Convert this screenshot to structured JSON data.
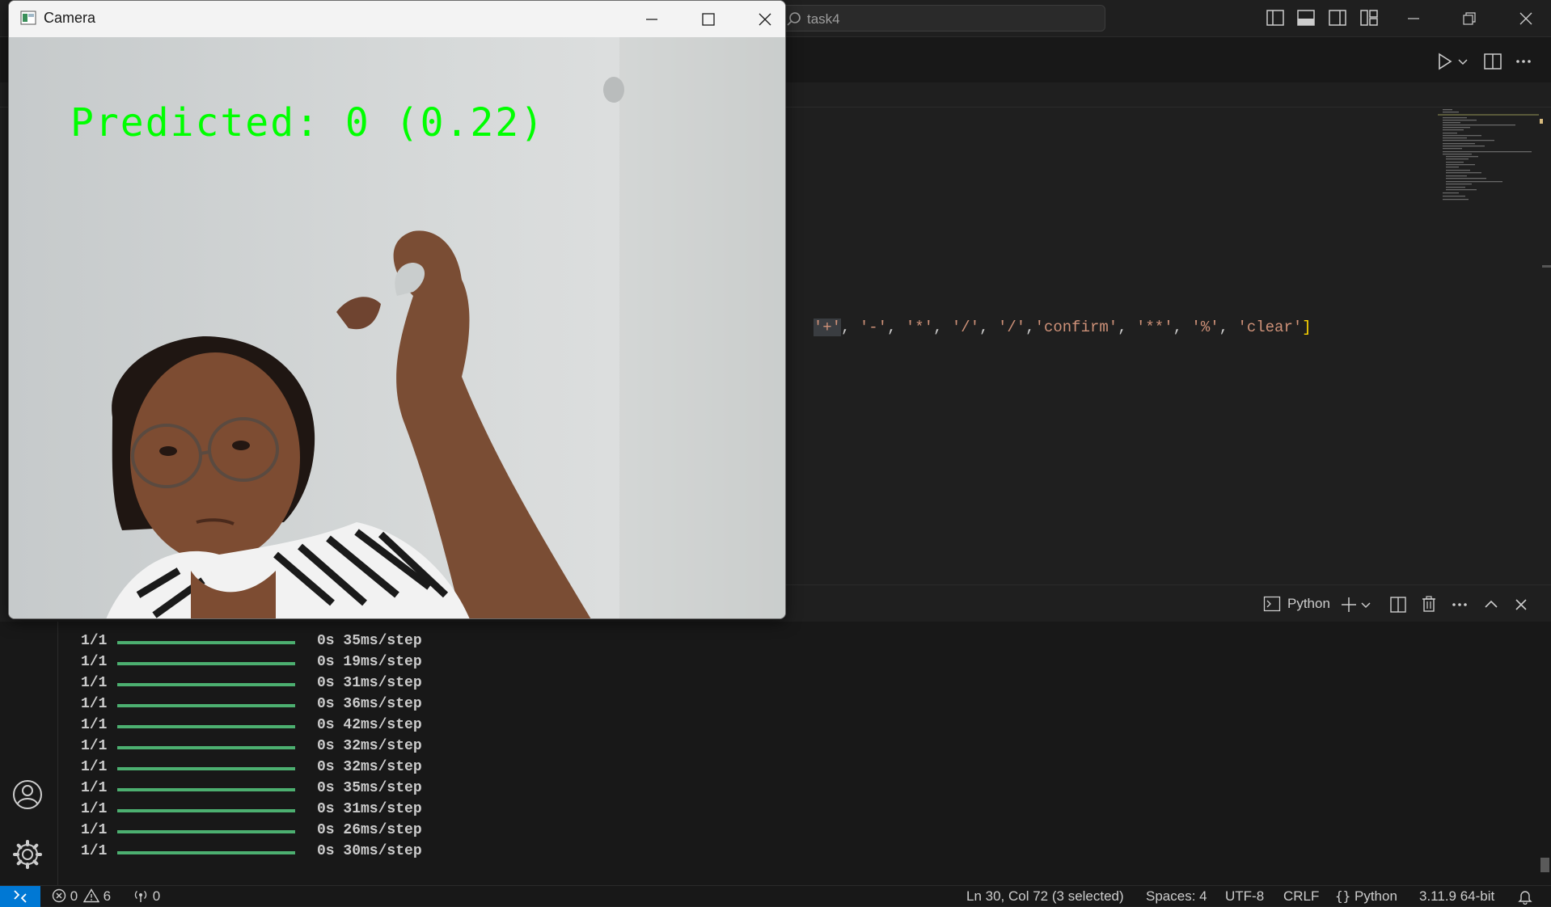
{
  "titlebar": {
    "search_text": "task4"
  },
  "camera_window": {
    "title": "Camera",
    "prediction_text": "Predicted: 0 (0.22)"
  },
  "editor": {
    "code_segments": [
      "'+'",
      ", ",
      "'-'",
      ", ",
      "'*'",
      ", ",
      "'/'",
      ", ",
      "'/'",
      ",",
      "'confirm'",
      ", ",
      "'**'",
      ", ",
      "'%'",
      ", ",
      "'clear'",
      "]"
    ]
  },
  "panel": {
    "terminal_profile": "Python",
    "lines": [
      {
        "count": "1/1",
        "time": "0s 35ms/step"
      },
      {
        "count": "1/1",
        "time": "0s 19ms/step"
      },
      {
        "count": "1/1",
        "time": "0s 31ms/step"
      },
      {
        "count": "1/1",
        "time": "0s 36ms/step"
      },
      {
        "count": "1/1",
        "time": "0s 42ms/step"
      },
      {
        "count": "1/1",
        "time": "0s 32ms/step"
      },
      {
        "count": "1/1",
        "time": "0s 32ms/step"
      },
      {
        "count": "1/1",
        "time": "0s 35ms/step"
      },
      {
        "count": "1/1",
        "time": "0s 31ms/step"
      },
      {
        "count": "1/1",
        "time": "0s 26ms/step"
      },
      {
        "count": "1/1",
        "time": "0s 30ms/step"
      }
    ]
  },
  "statusbar": {
    "errors": "0",
    "warnings": "6",
    "ports": "0",
    "cursor": "Ln 30, Col 72 (3 selected)",
    "spaces": "Spaces: 4",
    "encoding": "UTF-8",
    "eol": "CRLF",
    "language": "Python",
    "interpreter": "3.11.9 64-bit"
  },
  "colors": {
    "accent": "#0078d4",
    "prediction": "#00ff00",
    "progress": "#4caf70"
  }
}
